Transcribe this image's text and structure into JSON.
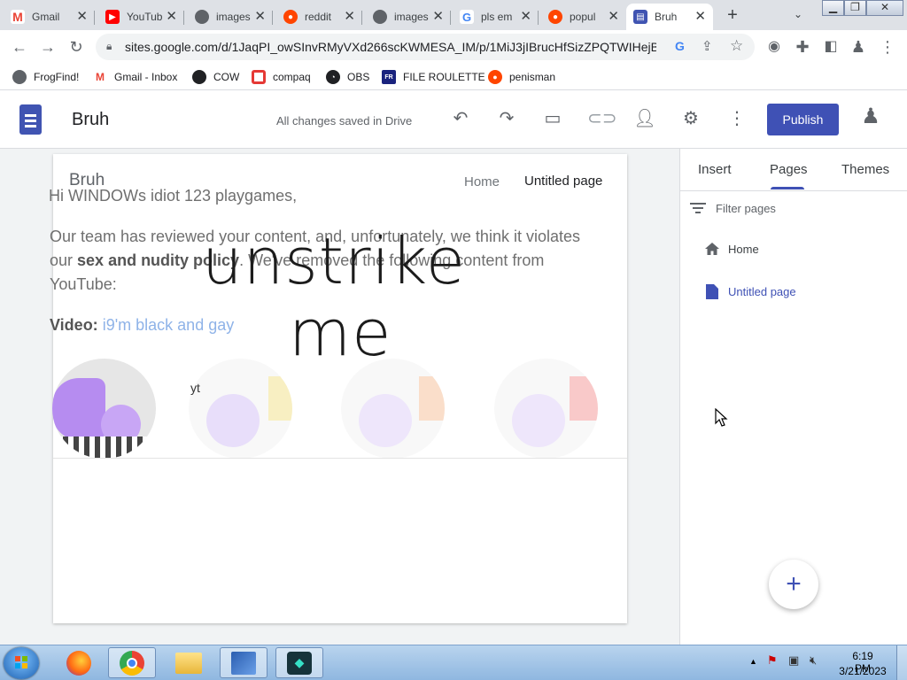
{
  "browser": {
    "tabs": [
      {
        "title": "Gmail",
        "icon": "gmail-icon",
        "color": "#ea4335"
      },
      {
        "title": "YouTube",
        "icon": "youtube-icon",
        "color": "#ff0000"
      },
      {
        "title": "images",
        "icon": "globe-icon",
        "color": "#5f6368"
      },
      {
        "title": "reddit",
        "icon": "reddit-icon",
        "color": "#ff4500"
      },
      {
        "title": "images",
        "icon": "globe-icon",
        "color": "#5f6368"
      },
      {
        "title": "pls em",
        "icon": "google-icon",
        "color": "#4285f4"
      },
      {
        "title": "popul",
        "icon": "reddit-icon",
        "color": "#ff4500"
      },
      {
        "title": "Bruh",
        "icon": "sites-icon",
        "color": "#4054b2",
        "active": true
      }
    ],
    "close_glyph": "✕",
    "new_tab": "+",
    "url": "sites.google.com/d/1JaqPI_owSInvRMyVXd266scKWMESA_IM/p/1MiJ3jIBrucHfSizZPQTWIHejBz5...",
    "bookmarks": [
      {
        "label": "FrogFind!",
        "icon": "globe-icon",
        "color": "#5f6368"
      },
      {
        "label": "Gmail - Inbox",
        "icon": "gmail-icon",
        "color": "#ea4335"
      },
      {
        "label": "COW",
        "icon": "globe-icon",
        "color": "#202124"
      },
      {
        "label": "compaq",
        "icon": "compaq-icon",
        "color": "#e53935"
      },
      {
        "label": "OBS",
        "icon": "github-icon",
        "color": "#202124"
      },
      {
        "label": "FILE ROULETTE",
        "icon": "file-roulette-icon",
        "color": "#1a237e"
      },
      {
        "label": "penisman",
        "icon": "reddit-icon",
        "color": "#ff4500"
      }
    ]
  },
  "sites": {
    "title": "Bruh",
    "saved_status": "All changes saved in Drive",
    "publish_label": "Publish",
    "accent": "#3f51b5"
  },
  "page": {
    "nav_brand": "Bruh",
    "nav_items": [
      "Home",
      "Untitled page"
    ],
    "greeting": "Hi WINDOWs idiot 123 playgames,",
    "p1": "Our team has reviewed your content, and, unfortunately, we think it violates",
    "p2_pre": "our ",
    "p2_bold": "sex and nudity policy",
    "p2_post": ". We've removed the following content from",
    "p3": "YouTube:",
    "video_label": "Video:",
    "video_title": "i9'm black and gay",
    "overlay_line1": "unstrike",
    "overlay_line2": "me",
    "thumb_label": "yt"
  },
  "panel": {
    "tabs": [
      "Insert",
      "Pages",
      "Themes"
    ],
    "active_tab": "Pages",
    "filter_placeholder": "Filter pages",
    "pages": [
      {
        "label": "Home",
        "icon": "home-icon"
      },
      {
        "label": "Untitled page",
        "icon": "page-icon",
        "selected": true
      }
    ],
    "add_glyph": "+"
  },
  "taskbar": {
    "apps": [
      "firefox-icon",
      "chrome-icon",
      "explorer-icon",
      "paint-icon",
      "filmora-icon"
    ],
    "time": "6:19 PM",
    "date": "3/21/2023"
  }
}
